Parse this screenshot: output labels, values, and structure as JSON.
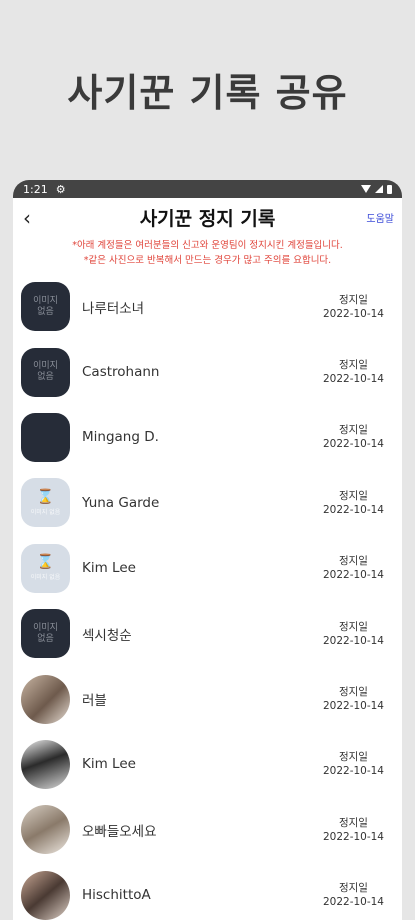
{
  "promo": {
    "title": "사기꾼 기록 공유"
  },
  "status_bar": {
    "time": "1:21"
  },
  "header": {
    "title": "사기꾼 정지 기록",
    "help_label": "도움말"
  },
  "notice": {
    "line1": "*아래 계정들은 여러분들의 신고와 운영팀이 정지시킨 계정들입니다.",
    "line2": "*같은 사진으로 반복해서 만드는 경우가 많고 주의를 요합니다."
  },
  "no_image_label": [
    "이미지",
    "없음"
  ],
  "light_avatar_caption": "이미지 없음",
  "records": [
    {
      "name": "나루터소녀",
      "status": "정지일",
      "date": "2022-10-14",
      "avatar": "no-image"
    },
    {
      "name": "Castrohann",
      "status": "정지일",
      "date": "2022-10-14",
      "avatar": "no-image"
    },
    {
      "name": "Mingang D.",
      "status": "정지일",
      "date": "2022-10-14",
      "avatar": "dark"
    },
    {
      "name": "Yuna Garde",
      "status": "정지일",
      "date": "2022-10-14",
      "avatar": "placeholder"
    },
    {
      "name": "Kim Lee",
      "status": "정지일",
      "date": "2022-10-14",
      "avatar": "placeholder"
    },
    {
      "name": "섹시청순",
      "status": "정지일",
      "date": "2022-10-14",
      "avatar": "no-image"
    },
    {
      "name": "러블",
      "status": "정지일",
      "date": "2022-10-14",
      "avatar": "photo"
    },
    {
      "name": "Kim Lee",
      "status": "정지일",
      "date": "2022-10-14",
      "avatar": "photo"
    },
    {
      "name": "오빠들오세요",
      "status": "정지일",
      "date": "2022-10-14",
      "avatar": "photo"
    },
    {
      "name": "HischittoA",
      "status": "정지일",
      "date": "2022-10-14",
      "avatar": "photo"
    }
  ],
  "colors": {
    "notice": "#e0443a",
    "link": "#3b4bd8",
    "avatar_dark": "#262c38",
    "avatar_light": "#d6dde6"
  }
}
